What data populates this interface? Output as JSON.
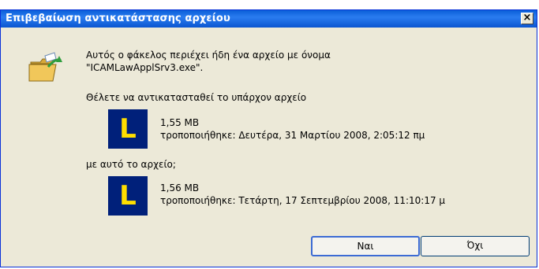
{
  "window": {
    "title": "Επιβεβαίωση αντικατάστασης αρχείου"
  },
  "message": {
    "line1": "Αυτός ο φάκελος περιέχει ήδη ένα αρχείο με όνομα",
    "line2": "\"ICAMLawApplSrv3.exe\".",
    "replace_question": "Θέλετε να αντικατασταθεί το υπάρχον αρχείο",
    "with_this": "με αυτό το αρχείο;"
  },
  "existing_file": {
    "icon_letter": "L",
    "size": "1,55 MB",
    "modified": "τροποποιήθηκε: Δευτέρα, 31 Μαρτίου 2008, 2:05:12 πμ"
  },
  "new_file": {
    "icon_letter": "L",
    "size": "1,56 MB",
    "modified": "τροποποιήθηκε: Τετάρτη, 17 Σεπτεμβρίου 2008, 11:10:17 μ"
  },
  "buttons": {
    "yes": "Ναι",
    "no": "Όχι"
  },
  "close_glyph": "×",
  "icons": {
    "header": "folder-replace-icon",
    "file": "file-L-icon"
  }
}
